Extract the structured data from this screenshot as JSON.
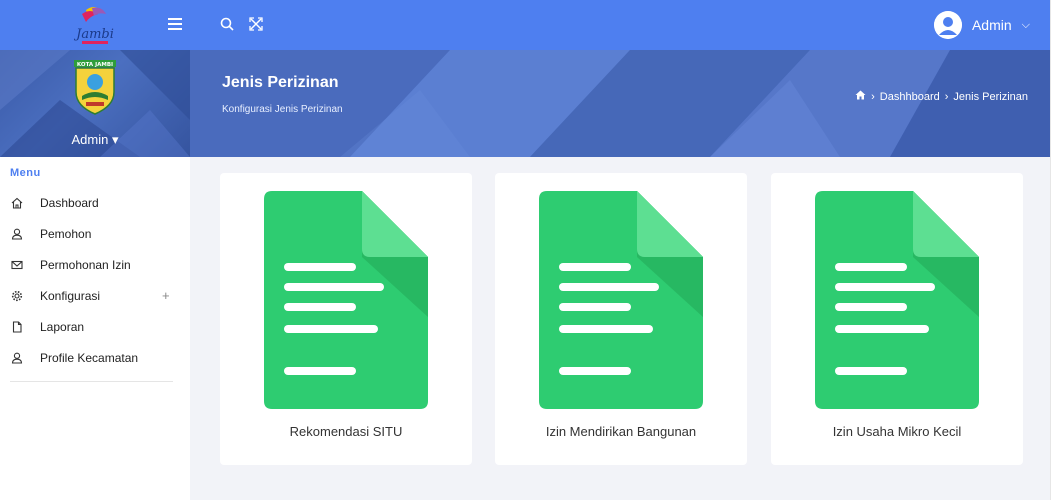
{
  "topbar": {
    "menu_icon": "hamburger-icon",
    "search_icon": "search-icon",
    "fullscreen_icon": "fullscreen-icon",
    "user_name": "Admin",
    "caret": "⌵"
  },
  "sidebar": {
    "emblem_text": "KOTA JAMBI",
    "user_label": "Admin",
    "user_caret": "▾",
    "menu_title": "Menu",
    "items": [
      {
        "label": "Dashboard",
        "icon": "home-icon"
      },
      {
        "label": "Pemohon",
        "icon": "user-icon"
      },
      {
        "label": "Permohonan Izin",
        "icon": "mail-icon"
      },
      {
        "label": "Konfigurasi",
        "icon": "gear-icon",
        "expand": "+"
      },
      {
        "label": "Laporan",
        "icon": "file-icon"
      },
      {
        "label": "Profile Kecamatan",
        "icon": "user-icon"
      }
    ]
  },
  "header": {
    "title": "Jenis Perizinan",
    "subtitle": "Konfigurasi Jenis Perizinan",
    "breadcrumb": {
      "home_icon": "home-icon",
      "sep": "›",
      "item1": "Dashhboard",
      "item2": "Jenis Perizinan"
    }
  },
  "cards": [
    {
      "label": "Rekomendasi SITU",
      "icon": "document-icon"
    },
    {
      "label": "Izin Mendirikan Bangunan",
      "icon": "document-icon"
    },
    {
      "label": "Izin Usaha Mikro Kecil",
      "icon": "document-icon"
    }
  ],
  "colors": {
    "primary": "#4e7ff0",
    "doc_green": "#2ecc71",
    "doc_fold": "#5ddf92",
    "doc_shadow": "#27b862"
  }
}
